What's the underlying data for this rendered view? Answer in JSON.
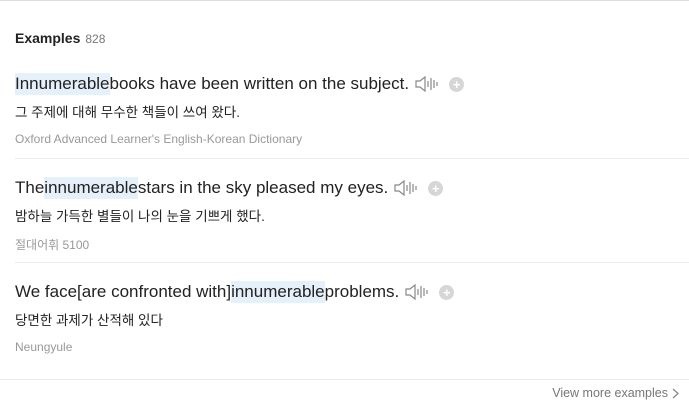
{
  "examples": {
    "title": "Examples",
    "count": "828",
    "items": [
      {
        "pre": "",
        "highlight": "Innumerable",
        "post": " books have been written on the subject.",
        "translation": "그 주제에 대해 무수한 책들이 쓰여 왔다.",
        "source": "Oxford Advanced Learner's English-Korean Dictionary"
      },
      {
        "pre": "The ",
        "highlight": "innumerable",
        "post": " stars in the sky pleased my eyes.",
        "translation": "밤하늘 가득한 별들이 나의 눈을 기쁘게 했다.",
        "source": "절대어휘 5100"
      },
      {
        "pre": "We face[are confronted with] ",
        "highlight": "innumerable",
        "post": " problems.",
        "translation": "당면한 과제가 산적해 있다",
        "source": "Neungyule"
      }
    ],
    "more_label": "View more examples",
    "icons": {
      "speaker": "speaker-icon",
      "add": "plus-circle-icon",
      "chevron": "chevron-right-icon"
    },
    "colors": {
      "highlight": "#e6f0fb",
      "muted": "#999999",
      "plus_bg": "#d6d6d6"
    }
  }
}
